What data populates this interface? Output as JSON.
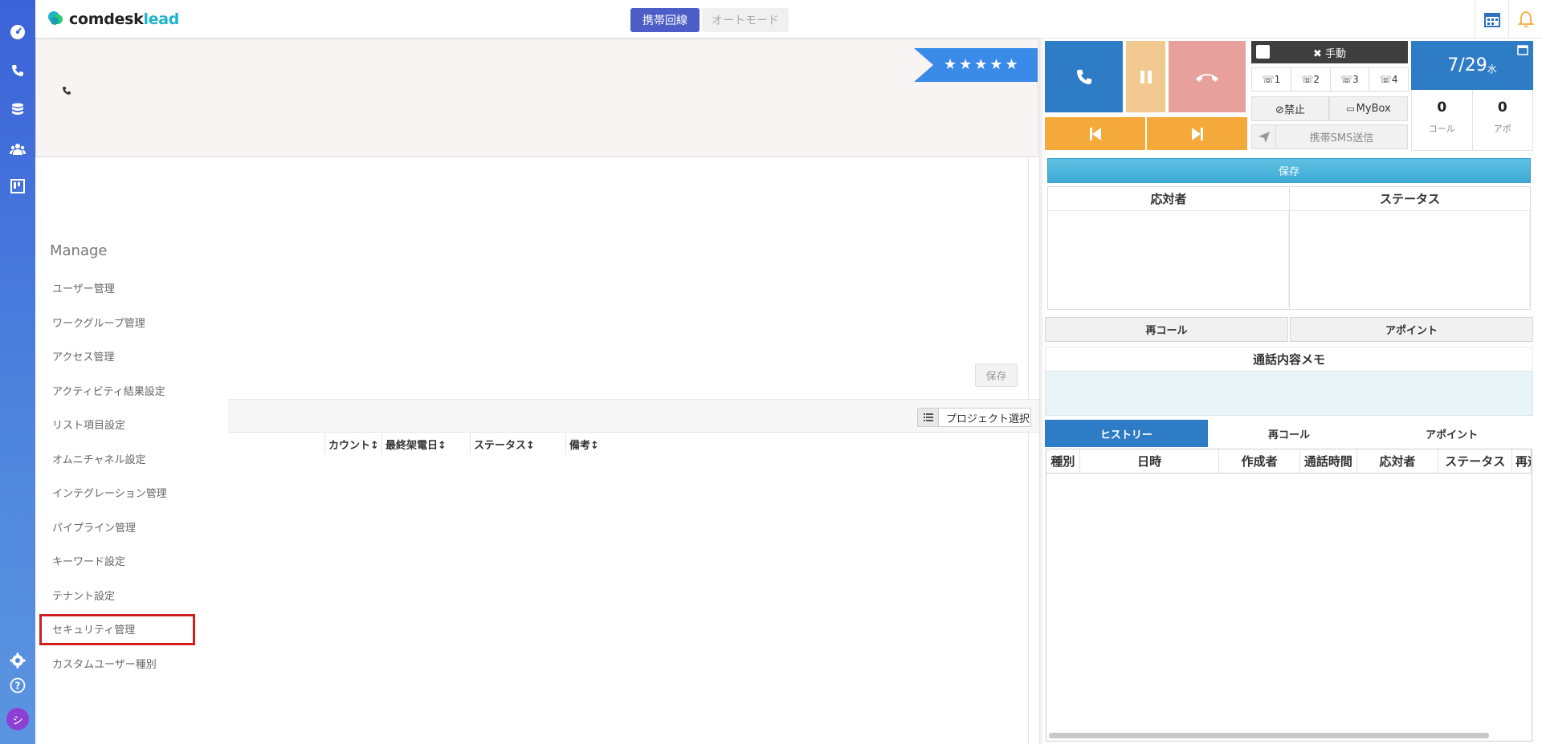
{
  "app": {
    "logo_main": "comdesk",
    "logo_accent": "lead"
  },
  "topbar": {
    "mode_active": "携帯回線",
    "mode_inactive": "オートモード"
  },
  "rail": {
    "icons": [
      "dashboard-icon",
      "phone-icon",
      "database-icon",
      "users-icon",
      "board-icon",
      "gear-icon",
      "help-icon"
    ],
    "avatar_initial": "シ"
  },
  "contact": {
    "rating_stars": "★★★★★"
  },
  "left": {
    "save_label": "保存",
    "project_select_label": "プロジェクト選択",
    "columns": [
      "カウント↕",
      "最終架電日↕",
      "ステータス↕",
      "備考↕"
    ]
  },
  "manage": {
    "title": "Manage",
    "items": [
      "ユーザー管理",
      "ワークグループ管理",
      "アクセス管理",
      "アクティビティ結果設定",
      "リスト項目設定",
      "オムニチャネル設定",
      "インテグレーション管理",
      "パイプライン管理",
      "キーワード設定",
      "テナント設定",
      "セキュリティ管理",
      "カスタムユーザー種別"
    ],
    "highlighted": "セキュリティ管理"
  },
  "dialer": {
    "manual_label": "✖ 手動",
    "lines": [
      "1",
      "2",
      "3",
      "4"
    ],
    "ban_label": "⊘禁止",
    "mybox_label": "MyBox",
    "sms_label": "携帯SMS送信",
    "date_main": "7/29",
    "date_weekday": "水",
    "call_count": "0",
    "call_label": "コール",
    "appo_count": "0",
    "appo_label": "アポ"
  },
  "right": {
    "save_label": "保存",
    "responder_label": "応対者",
    "status_label": "ステータス",
    "recall_label": "再コール",
    "appoint_label": "アポイント",
    "memo_label": "通話内容メモ",
    "tabs": [
      "ヒストリー",
      "再コール",
      "アポイント"
    ],
    "history_columns": [
      "種別",
      "日時",
      "作成者",
      "通話時間",
      "応対者",
      "ステータス",
      "再通"
    ]
  },
  "colors": {
    "accent": "#2f7cc6",
    "mode_active": "#4c5dc7",
    "highlight": "#d0201e",
    "ribbon": "#3a8be8"
  }
}
